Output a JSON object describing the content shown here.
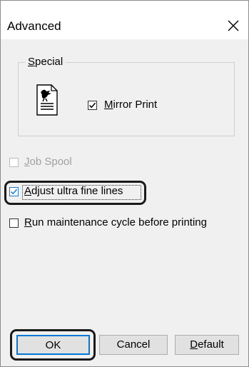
{
  "window": {
    "title": "Advanced",
    "close_glyph": "✕"
  },
  "special_group": {
    "label_prefix": "",
    "label_underlined": "S",
    "label_rest": "pecial",
    "icon": "printer-document-icon",
    "mirror_print": {
      "checked": true,
      "label_underlined": "M",
      "label_rest": "irror Print"
    }
  },
  "options": {
    "job_spool": {
      "checked": false,
      "enabled": false,
      "label_underlined": "J",
      "label_rest": "ob Spool"
    },
    "adjust_fine_lines": {
      "checked": true,
      "enabled": true,
      "label_underlined": "A",
      "label_rest": "djust ultra fine lines"
    },
    "maintenance_cycle": {
      "checked": false,
      "enabled": true,
      "label_underlined": "R",
      "label_rest": "un maintenance cycle before printing"
    }
  },
  "buttons": {
    "ok": "OK",
    "cancel": "Cancel",
    "default_underlined": "D",
    "default_rest": "efault"
  },
  "colors": {
    "accent": "#0078d7",
    "callout": "#1a1a1a"
  }
}
